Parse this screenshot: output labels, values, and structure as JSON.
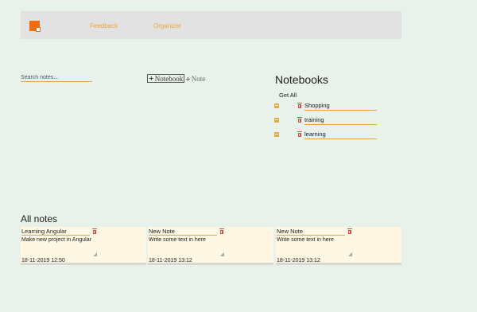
{
  "navbar": {
    "links": [
      "Feedback",
      "Organizer"
    ]
  },
  "toolbar": {
    "search_placeholder": "Search notes...",
    "add_notebook_label": "Notebook",
    "add_note_label": "Note"
  },
  "notebooks": {
    "title": "Notebooks",
    "get_all_label": "Get All",
    "items": [
      {
        "name": "Shopping"
      },
      {
        "name": "training"
      },
      {
        "name": "learning"
      }
    ]
  },
  "notes": {
    "title": "All notes",
    "items": [
      {
        "title": "Learning Angular",
        "body": "Make new project in Angular",
        "date": "18-11-2019 12:50"
      },
      {
        "title": "New Note",
        "body": "Write some text in here",
        "date": "18-11-2019 13:12"
      },
      {
        "title": "New Note",
        "body": "Write some text in here",
        "date": "18-11-2019 13:12"
      }
    ]
  },
  "colors": {
    "accent": "#f26b0f",
    "link": "#f0a33a",
    "danger": "#e84a3f",
    "note_bg": "#fef7e4",
    "page_bg": "#e8f1ea"
  }
}
